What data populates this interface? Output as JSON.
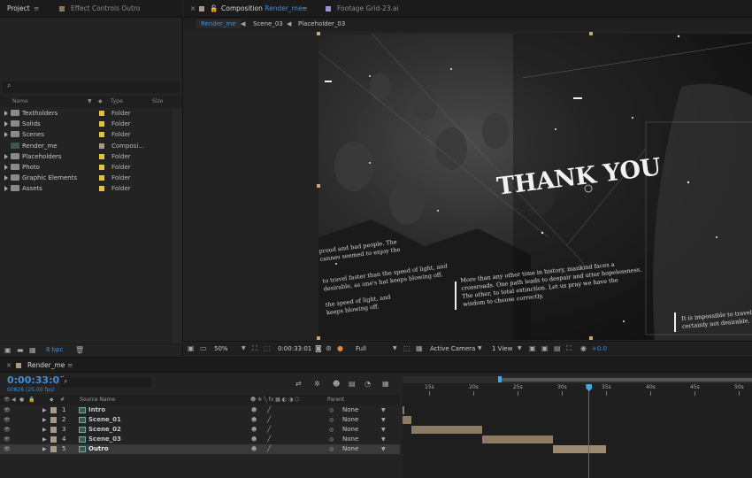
{
  "project_tabs": {
    "project": "Project",
    "effect_controls": "Effect Controls Outro"
  },
  "viewer_tabs": {
    "composition_prefix": "Composition",
    "composition_name": "Render_me",
    "footage": "Footage Grid-23.ai"
  },
  "breadcrumbs": [
    "Render_me",
    "Scene_03",
    "Placeholder_03"
  ],
  "project_columns": {
    "name": "Name",
    "type": "Type",
    "size": "Size"
  },
  "project_items": [
    {
      "name": "Textholders",
      "type": "Folder",
      "color": "#e3c33c",
      "kind": "folder"
    },
    {
      "name": "Solids",
      "type": "Folder",
      "color": "#e3c33c",
      "kind": "folder"
    },
    {
      "name": "Scenes",
      "type": "Folder",
      "color": "#e3c33c",
      "kind": "folder"
    },
    {
      "name": "Render_me",
      "type": "Composi...",
      "color": "#a89a85",
      "kind": "comp"
    },
    {
      "name": "Placeholders",
      "type": "Folder",
      "color": "#e3c33c",
      "kind": "folder"
    },
    {
      "name": "Photo",
      "type": "Folder",
      "color": "#e3c33c",
      "kind": "folder"
    },
    {
      "name": "Graphic Elements",
      "type": "Folder",
      "color": "#e3c33c",
      "kind": "folder"
    },
    {
      "name": "Assets",
      "type": "Folder",
      "color": "#e3c33c",
      "kind": "folder"
    }
  ],
  "project_footer": {
    "bpc": "8 bpc"
  },
  "viewer_text": {
    "title": "THANK YOU",
    "left_a": "proud and bad people. The",
    "left_b": "cannes seemed to enjoy the",
    "left_c": "to travel faster than the speed of light, and",
    "left_d": "desirable, as one's hat keeps blowing off.",
    "left_e": "the speed of light, and",
    "left_f": "keeps blowing off.",
    "center_1": "More than any other time in history, mankind faces a",
    "center_2": "crossroads. One path leads to despair and utter hopelessness.",
    "center_3": "The other, to total extinction. Let us pray we have the",
    "center_4": "wisdom to choose correctly.",
    "right_1": "It is impossible to travel fa",
    "right_2": "certainly not desirable, as"
  },
  "viewer_toolbar": {
    "zoom": "50%",
    "timecode": "0:00:33:01",
    "resolution": "Full",
    "camera": "Active Camera",
    "views": "1 View",
    "exposure": "+0.0"
  },
  "timeline": {
    "tab": "Render_me",
    "timecode": "0:00:33:01",
    "frame_info": "00826 (25.00 fps)",
    "col_source": "Source Name",
    "col_parent": "Parent",
    "ruler": [
      "15s",
      "20s",
      "25s",
      "30s",
      "35s",
      "40s",
      "45s",
      "50s"
    ],
    "playhead_seconds": 33.04,
    "layers": [
      {
        "num": "1",
        "name": "Intro",
        "parent": "None",
        "color": "#a89a85",
        "start_s": 12.0,
        "end_s": 12.0
      },
      {
        "num": "2",
        "name": "Scene_01",
        "parent": "None",
        "color": "#a89a85",
        "start_s": 12.0,
        "end_s": 13.0
      },
      {
        "num": "3",
        "name": "Scene_02",
        "parent": "None",
        "color": "#a89a85",
        "start_s": 13.0,
        "end_s": 21.0
      },
      {
        "num": "4",
        "name": "Scene_03",
        "parent": "None",
        "color": "#a89a85",
        "start_s": 21.0,
        "end_s": 29.0
      },
      {
        "num": "5",
        "name": "Outro",
        "parent": "None",
        "color": "#a89a85",
        "start_s": 29.0,
        "end_s": 35.0
      }
    ]
  }
}
